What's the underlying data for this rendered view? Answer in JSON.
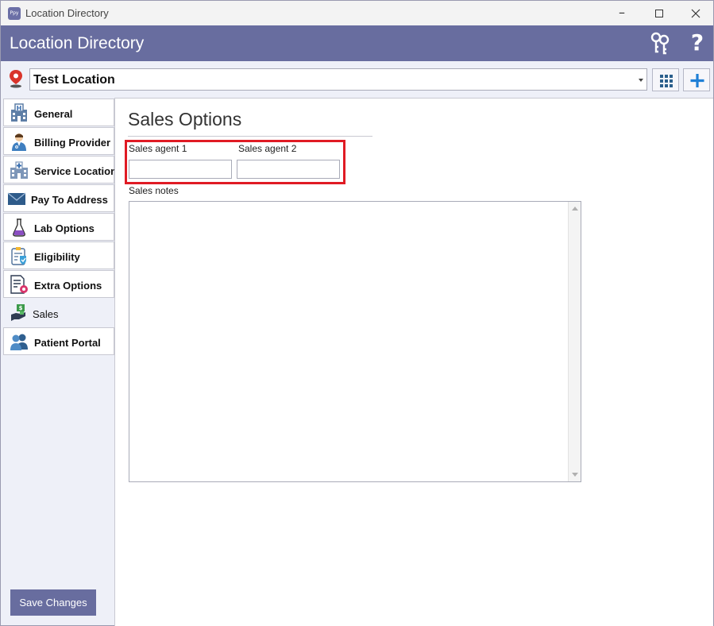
{
  "window": {
    "title": "Location Directory",
    "app_icon_text": "Ppy"
  },
  "header": {
    "title": "Location Directory",
    "help_label": "?"
  },
  "location": {
    "selected": "Test Location"
  },
  "sidebar": {
    "items": [
      {
        "label": "General",
        "icon": "hospital-building-icon"
      },
      {
        "label": "Billing Provider",
        "icon": "doctor-icon"
      },
      {
        "label": "Service Location",
        "icon": "clinic-building-icon"
      },
      {
        "label": "Pay To Address",
        "icon": "envelope-icon"
      },
      {
        "label": "Lab Options",
        "icon": "flask-icon"
      },
      {
        "label": "Eligibility",
        "icon": "clipboard-check-icon"
      },
      {
        "label": "Extra Options",
        "icon": "document-gear-icon"
      },
      {
        "label": "Sales",
        "icon": "money-hand-icon",
        "active": true
      },
      {
        "label": "Patient Portal",
        "icon": "users-icon"
      }
    ]
  },
  "footer": {
    "save_label": "Save Changes"
  },
  "content": {
    "title": "Sales Options",
    "agent1_label": "Sales agent 1",
    "agent1_value": "",
    "agent2_label": "Sales agent 2",
    "agent2_value": "",
    "notes_label": "Sales notes",
    "notes_value": ""
  },
  "colors": {
    "brand": "#686d9f",
    "highlight": "#e01b24",
    "accent_blue": "#1e7fd6"
  }
}
